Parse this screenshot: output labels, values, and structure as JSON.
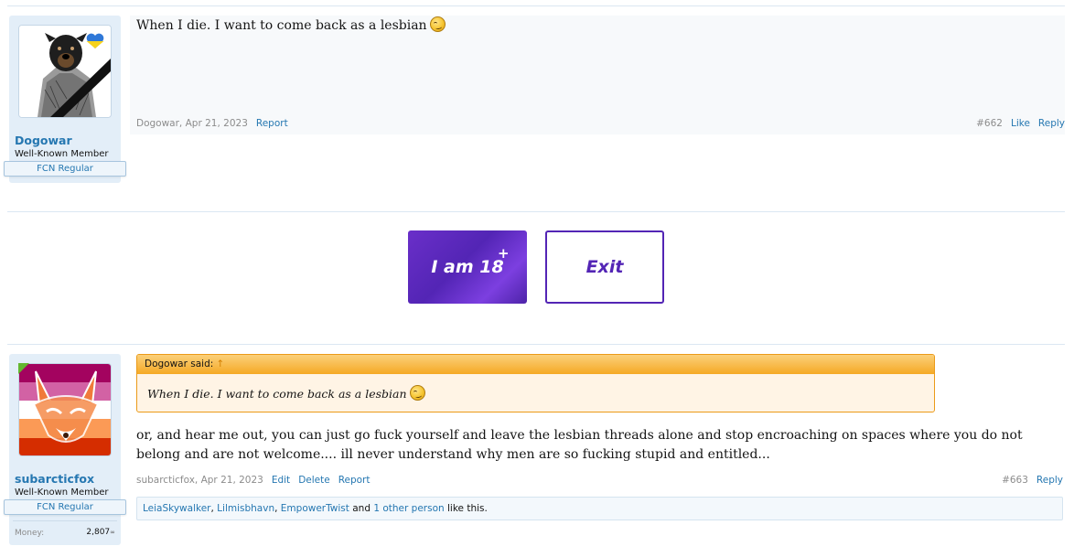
{
  "posts": [
    {
      "username": "Dogowar",
      "user_title": "Well-Known Member",
      "user_banner": "FCN Regular",
      "avatar_icon": "dog-soldier-avatar-with-ukraine-heart",
      "text": "When I die. I want to come back as a lesbian",
      "emoji_icon": "confused-smiley-icon",
      "meta": "Dogowar, Apr 21, 2023",
      "report_label": "Report",
      "post_number": "#662",
      "like_label": "Like",
      "reply_label": "Reply"
    },
    {
      "username": "subarcticfox",
      "user_title": "Well-Known Member",
      "user_banner": "FCN Regular",
      "avatar_icon": "fox-lesbian-flag-avatar",
      "money_label": "Money:",
      "money_value": "2,807",
      "quote": {
        "author": "Dogowar said:",
        "arrow": "↑",
        "text": "When I die. I want to come back as a lesbian"
      },
      "text": "or, and hear me out, you can just go fuck yourself and leave the lesbian threads alone and stop encroaching on spaces where you do not belong and are not welcome.... ill never understand why men are so fucking stupid and entitled...",
      "meta": "subarcticfox, Apr 21, 2023",
      "edit_label": "Edit",
      "delete_label": "Delete",
      "report_label": "Report",
      "post_number": "#663",
      "reply_label": "Reply",
      "likes": {
        "users": [
          "LeiaSkywalker",
          "Lilmisbhavn",
          "EmpowerTwist"
        ],
        "sep": ", ",
        "and": " and ",
        "others": "1 other person",
        "suffix": " like this."
      }
    }
  ],
  "age_gate": {
    "confirm_label": "I am 18",
    "confirm_plus": "+",
    "exit_label": "Exit"
  },
  "colors": {
    "link": "#2577b1",
    "gate_purple": "#5325b5",
    "quote_border": "#eb9a18"
  }
}
